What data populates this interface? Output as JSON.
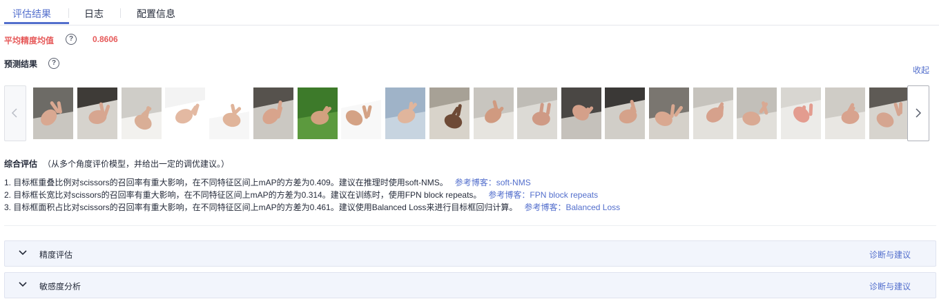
{
  "tabs": [
    {
      "label": "评估结果",
      "active": true
    },
    {
      "label": "日志",
      "active": false
    },
    {
      "label": "配置信息",
      "active": false
    }
  ],
  "map": {
    "label": "平均精度均值",
    "value": "0.8606",
    "help_icon": "question-circle-icon",
    "color": "#e65959"
  },
  "prediction": {
    "label": "预测结果",
    "help_icon": "question-circle-icon",
    "collapse_label": "收起"
  },
  "gallery": {
    "prev_icon": "chevron-left-icon",
    "next_icon": "chevron-right-icon",
    "images": [
      {
        "subject": "hand-rock"
      },
      {
        "subject": "hand-scissors"
      },
      {
        "subject": "hands-paper-rock"
      },
      {
        "subject": "hands-white-bg"
      },
      {
        "subject": "hand-scissors-white"
      },
      {
        "subject": "hands-floor"
      },
      {
        "subject": "hands-grass"
      },
      {
        "subject": "hands-paper-white"
      },
      {
        "subject": "hands-scissors-blue"
      },
      {
        "subject": "hand-scissors-floor"
      },
      {
        "subject": "hand-rock-floor"
      },
      {
        "subject": "hand-floor"
      },
      {
        "subject": "hand-scissors-dark"
      },
      {
        "subject": "hand-scissors-rock"
      },
      {
        "subject": "hand-scissors-floor2"
      },
      {
        "subject": "hand-paper-floor"
      },
      {
        "subject": "hand-rock-floor2"
      },
      {
        "subject": "hand-paper-red"
      },
      {
        "subject": "hand-paper-floor2"
      },
      {
        "subject": "hand-scissors-shoe"
      }
    ]
  },
  "summary": {
    "title": "综合评估",
    "subtitle": "（从多个角度评价模型，并给出一定的调优建议。）",
    "items": [
      {
        "text": "1. 目标框重叠比例对scissors的召回率有重大影响，在不同特征区间上mAP的方差为0.409。建议在推理时使用soft-NMS。",
        "ref": "参考博客：soft-NMS"
      },
      {
        "text": "2. 目标框长宽比对scissors的召回率有重大影响，在不同特征区间上mAP的方差为0.314。建议在训练时，使用FPN block repeats。",
        "ref": "参考博客：FPN block repeats"
      },
      {
        "text": "3. 目标框面积占比对scissors的召回率有重大影响，在不同特征区间上mAP的方差为0.461。建议使用Balanced Loss来进行目标框回归计算。",
        "ref": "参考博客：Balanced Loss"
      }
    ]
  },
  "panels": [
    {
      "title": "精度评估",
      "link": "诊断与建议",
      "icon": "chevron-down-icon"
    },
    {
      "title": "敏感度分析",
      "link": "诊断与建议",
      "icon": "chevron-down-icon"
    }
  ],
  "colors": {
    "accent": "#526ecc",
    "danger": "#e65959",
    "panel_bg": "#f2f5fc"
  }
}
